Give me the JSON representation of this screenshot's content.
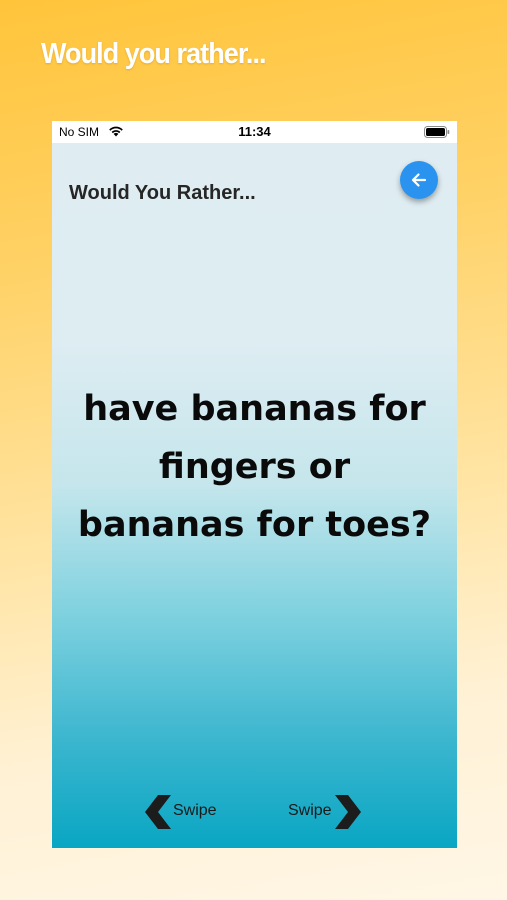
{
  "promo": {
    "title": "Would you rather..."
  },
  "status_bar": {
    "carrier": "No SIM",
    "time": "11:34",
    "wifi_icon": "wifi-icon",
    "battery_icon": "battery-icon"
  },
  "header": {
    "title": "Would You Rather...",
    "back_icon": "arrow-left-icon",
    "back_button_color": "#2a93f0"
  },
  "question": {
    "text": "have bananas for fingers or bananas for toes?"
  },
  "footer": {
    "swipe_left_label": "Swipe",
    "swipe_right_label": "Swipe",
    "left_icon": "chevron-left-icon",
    "right_icon": "chevron-right-icon"
  },
  "colors": {
    "background_top": "#ffc43a",
    "screen_top": "#dfedf3",
    "screen_bottom": "#09a6c3"
  }
}
